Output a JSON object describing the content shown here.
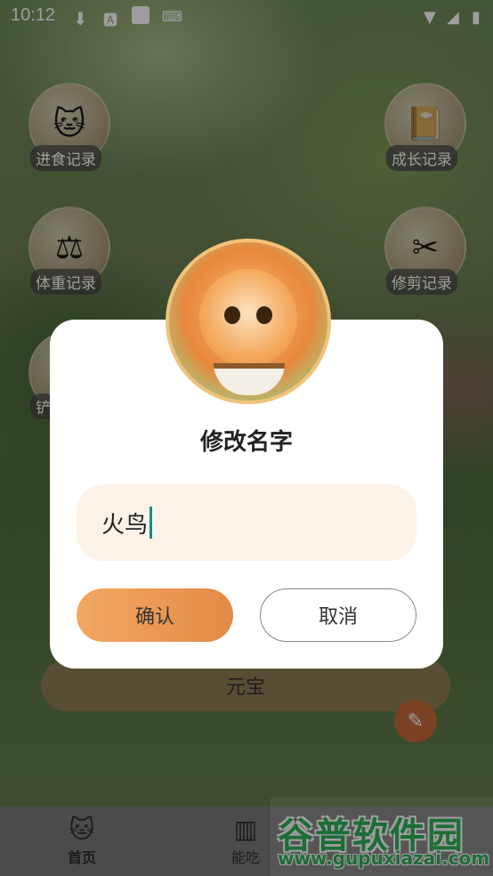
{
  "status_bar": {
    "time": "10:12"
  },
  "features": {
    "eat": "进食记录",
    "growth": "成长记录",
    "weight": "体重记录",
    "trim": "修剪记录",
    "partial": "铲"
  },
  "currency_label": "元宝",
  "dialog": {
    "title": "修改名字",
    "name_value": "火鸟",
    "confirm_label": "确认",
    "cancel_label": "取消"
  },
  "nav": {
    "home": "首页",
    "food": "能吃"
  },
  "watermark": {
    "brand": "谷普软件园",
    "url": "www.gupuxiazai.com"
  },
  "colors": {
    "accent": "#e38a44",
    "field_bg": "#fcf3e8",
    "caret": "#1a8a86"
  }
}
